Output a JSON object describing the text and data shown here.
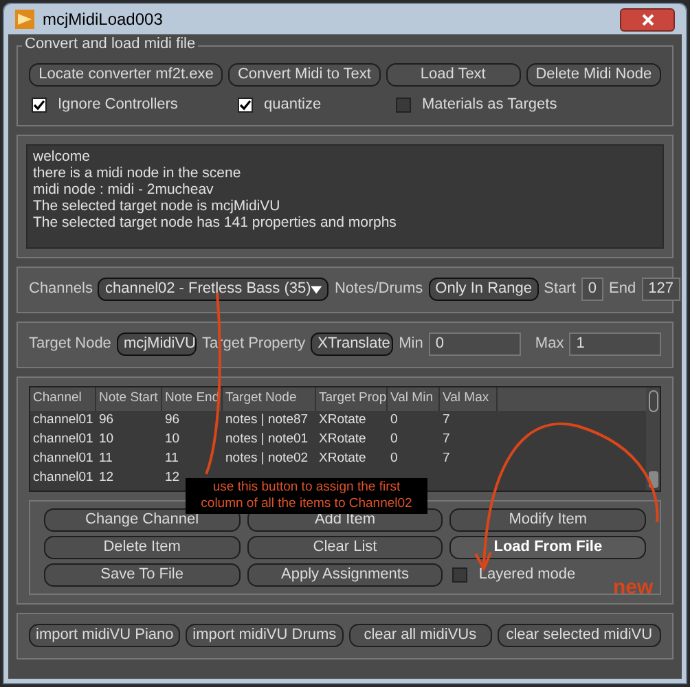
{
  "window": {
    "title": "mcjMidiLoad003"
  },
  "convert_group": {
    "title": "Convert and load midi file",
    "buttons": [
      "Locate converter mf2t.exe",
      "Convert Midi to Text",
      "Load Text",
      "Delete Midi Node"
    ],
    "checkboxes": [
      {
        "label": "Ignore Controllers",
        "checked": true
      },
      {
        "label": "quantize",
        "checked": true
      },
      {
        "label": "Materials as Targets",
        "checked": false
      }
    ]
  },
  "log": [
    "welcome",
    "there is a midi node in the scene",
    "midi node : midi - 2mucheav",
    "The selected target node is mcjMidiVU",
    "The selected target node has 141 properties and morphs"
  ],
  "channels": {
    "label": "Channels",
    "value": "channel02 - Fretless Bass (35)",
    "notes_label": "Notes/Drums",
    "notes_value": "Only In Range",
    "start_label": "Start",
    "start_value": "0",
    "end_label": "End",
    "end_value": "127"
  },
  "target": {
    "node_label": "Target Node",
    "node_value": "mcjMidiVU",
    "property_label": "Target Property",
    "property_value": "XTranslate",
    "min_label": "Min",
    "min_value": "0",
    "max_label": "Max",
    "max_value": "1"
  },
  "table": {
    "columns": [
      "Channel",
      "Note Start",
      "Note End",
      "Target Node",
      "Target Prop",
      "Val Min",
      "Val Max"
    ],
    "rows": [
      [
        "channel01",
        "96",
        "96",
        "notes | note87",
        "XRotate",
        "0",
        "7"
      ],
      [
        "channel01",
        "10",
        "10",
        "notes | note01",
        "XRotate",
        "0",
        "7"
      ],
      [
        "channel01",
        "11",
        "11",
        "notes | note02",
        "XRotate",
        "0",
        "7"
      ],
      [
        "channel01",
        "12",
        "12"
      ]
    ]
  },
  "action_buttons": [
    {
      "label": "Change Channel",
      "emphasized": false
    },
    {
      "label": "Add Item",
      "emphasized": false
    },
    {
      "label": "Modify Item",
      "emphasized": false
    },
    {
      "label": "Delete Item",
      "emphasized": false
    },
    {
      "label": "Clear List",
      "emphasized": false
    },
    {
      "label": "Load From File",
      "emphasized": true
    },
    {
      "label": "Save To File",
      "emphasized": false
    },
    {
      "label": "Apply Assignments",
      "emphasized": false
    }
  ],
  "layered_mode": {
    "label": "Layered mode",
    "checked": false
  },
  "annotations": {
    "callout": [
      "use this button to assign the first",
      "column of all the items to Channel02"
    ],
    "new_label": "new"
  },
  "bottom_buttons": [
    "import midiVU Piano",
    "import midiVU Drums",
    "clear all midiVUs",
    "clear selected midiVU"
  ]
}
